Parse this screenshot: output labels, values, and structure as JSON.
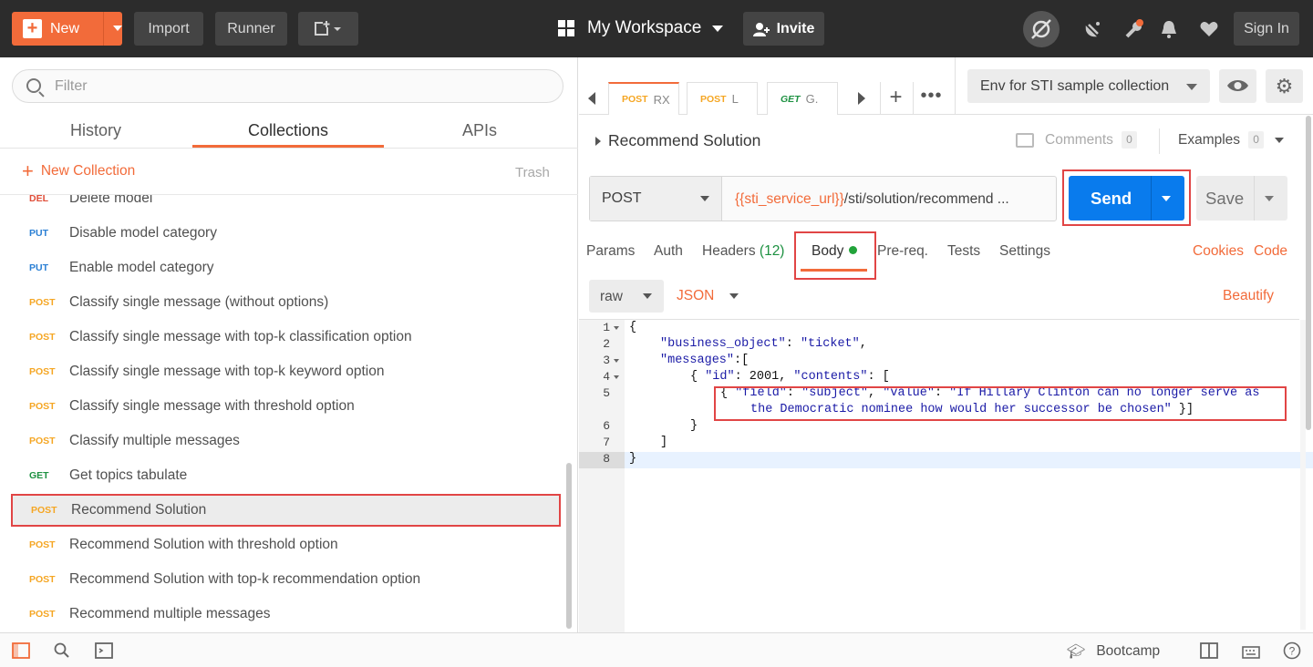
{
  "topbar": {
    "new_label": "New",
    "import_label": "Import",
    "runner_label": "Runner",
    "workspace_label": "My Workspace",
    "invite_label": "Invite",
    "signin_label": "Sign In"
  },
  "sidebar": {
    "filter_placeholder": "Filter",
    "tabs": [
      "History",
      "Collections",
      "APIs"
    ],
    "active_tab": "Collections",
    "new_collection_label": "New Collection",
    "trash_label": "Trash",
    "requests": [
      {
        "method": "DEL",
        "name": "Delete model"
      },
      {
        "method": "PUT",
        "name": "Disable model category"
      },
      {
        "method": "PUT",
        "name": "Enable model category"
      },
      {
        "method": "POST",
        "name": "Classify single message (without options)"
      },
      {
        "method": "POST",
        "name": "Classify single message with top-k classification option"
      },
      {
        "method": "POST",
        "name": "Classify single message with top-k keyword option"
      },
      {
        "method": "POST",
        "name": "Classify single message with threshold option"
      },
      {
        "method": "POST",
        "name": "Classify multiple messages"
      },
      {
        "method": "GET",
        "name": "Get topics tabulate"
      },
      {
        "method": "POST",
        "name": "Recommend Solution"
      },
      {
        "method": "POST",
        "name": "Recommend Solution with threshold option"
      },
      {
        "method": "POST",
        "name": "Recommend Solution with top-k recommendation option"
      },
      {
        "method": "POST",
        "name": "Recommend multiple messages"
      }
    ],
    "selected_request": "Recommend Solution"
  },
  "tabs": [
    {
      "method": "POST",
      "title": "RX"
    },
    {
      "method": "POST",
      "title": "L"
    },
    {
      "method": "GET",
      "title": "G."
    }
  ],
  "environment": {
    "selected": "Env for STI sample collection"
  },
  "request": {
    "title": "Recommend Solution",
    "comments_label": "Comments",
    "comments_count": "0",
    "examples_label": "Examples",
    "examples_count": "0",
    "method": "POST",
    "url_var": "{{sti_service_url}}",
    "url_path": "/sti/solution/recommend ...",
    "send_label": "Send",
    "save_label": "Save",
    "tabs": {
      "params": "Params",
      "auth": "Auth",
      "headers": "Headers",
      "headers_count": "(12)",
      "body": "Body",
      "prereq": "Pre-req.",
      "tests": "Tests",
      "settings": "Settings"
    },
    "cookies_label": "Cookies",
    "code_label": "Code",
    "body_mode": "raw",
    "body_format": "JSON",
    "beautify_label": "Beautify"
  },
  "editor": {
    "line_numbers": [
      "1",
      "2",
      "3",
      "4",
      "5",
      "6",
      "7",
      "8"
    ],
    "lines": {
      "l1": "{",
      "l2_key": "\"business_object\"",
      "l2_rest": ": ",
      "l2_val": "\"ticket\"",
      "l2_end": ",",
      "l3_key": "\"messages\"",
      "l3_rest": ":[",
      "l4_a": "{ ",
      "l4_key1": "\"id\"",
      "l4_b": ": 2001, ",
      "l4_key2": "\"contents\"",
      "l4_c": ": [",
      "l5_a": "{ ",
      "l5_key1": "\"field\"",
      "l5_b": ": ",
      "l5_val1": "\"subject\"",
      "l5_c": ", ",
      "l5_key2": "\"value\"",
      "l5_d": ": ",
      "l5_val2a": "\"If Hillary Clinton can no longer serve as",
      "l5_val2b": "the Democratic nominee how would her successor be chosen\"",
      "l5_e": " }]",
      "l6": "}",
      "l7": "]",
      "l8": "}"
    }
  },
  "bottombar": {
    "bootcamp_label": "Bootcamp"
  },
  "colors": {
    "accent": "#f26b3a",
    "send": "#097bed",
    "highlight_box": "#e14545",
    "post": "#f5a623",
    "put": "#2a7fd4",
    "get": "#1d9141",
    "del": "#e04e39"
  }
}
